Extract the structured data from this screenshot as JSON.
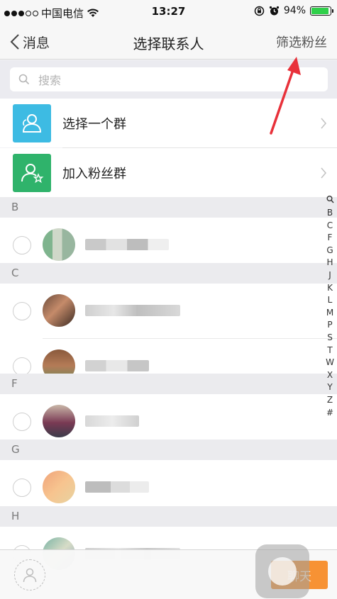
{
  "status_bar": {
    "carrier": "中国电信",
    "time": "13:27",
    "battery": "94%",
    "battery_level": 0.94
  },
  "nav": {
    "back_label": "消息",
    "title": "选择联系人",
    "right_action": "筛选粉丝"
  },
  "search": {
    "placeholder": "搜索"
  },
  "groups": [
    {
      "label": "选择一个群",
      "icon": "group-icon",
      "color": "#3dbbe3"
    },
    {
      "label": "加入粉丝群",
      "icon": "fan-group-icon",
      "color": "#2fb36b"
    }
  ],
  "sections": [
    "B",
    "C",
    "F",
    "G",
    "H"
  ],
  "index_letters": [
    "B",
    "C",
    "F",
    "G",
    "H",
    "J",
    "K",
    "L",
    "M",
    "P",
    "S",
    "T",
    "W",
    "X",
    "Y",
    "Z",
    "#"
  ],
  "bottom": {
    "chat_label": "聊天"
  },
  "colors": {
    "accent": "#f79234",
    "annotation_arrow": "#e8313a"
  }
}
